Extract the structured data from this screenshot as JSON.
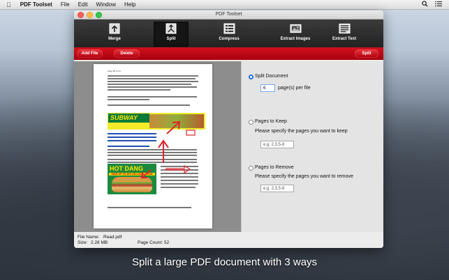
{
  "menubar": {
    "app_name": "PDF Toolset",
    "menus": [
      "File",
      "Edit",
      "Window",
      "Help"
    ]
  },
  "window": {
    "title": "PDF Toolset"
  },
  "toolbar": {
    "tools": [
      {
        "label": "Merge",
        "icon": "merge-icon"
      },
      {
        "label": "Split",
        "icon": "split-icon",
        "active": true
      },
      {
        "label": "Compress",
        "icon": "compress-icon"
      },
      {
        "label": "Extract Images",
        "icon": "extract-images-icon"
      },
      {
        "label": "Extract Text",
        "icon": "extract-text-icon"
      }
    ]
  },
  "actionbar": {
    "add_file": "Add File",
    "delete": "Delete",
    "split": "Split"
  },
  "preview": {
    "page_header": "Page 86 of 94",
    "ad_top_brand": "SUBWAY",
    "ad_bottom_title": "HOT DANG",
    "ad_bottom_sub": "SAVE UP TO 40% ON LOCAL FOOD"
  },
  "options": {
    "split_document": {
      "label": "Split  Document",
      "value": "6",
      "suffix": "page(s) per file",
      "selected": true
    },
    "pages_to_keep": {
      "label": "Pages to Keep",
      "hint": "Please specify the pages you want to keep",
      "placeholder": "e.g. 2,3,5-8",
      "selected": false
    },
    "pages_to_remove": {
      "label": "Pages to Remove",
      "hint": "Please specify the pages you want to remove",
      "placeholder": "e.g. 2,3,5-8",
      "selected": false
    }
  },
  "status": {
    "file_name_label": "File Name:",
    "file_name": "Read.pdf",
    "size_label": "Size:",
    "size": "2.28 MB",
    "page_count_label": "Page Count:",
    "page_count": "52"
  },
  "caption": "Split a large PDF document with 3 ways",
  "colors": {
    "accent_red": "#c40612",
    "toolbar_dark": "#2a2a2a",
    "radio_blue": "#2f7ee8"
  }
}
